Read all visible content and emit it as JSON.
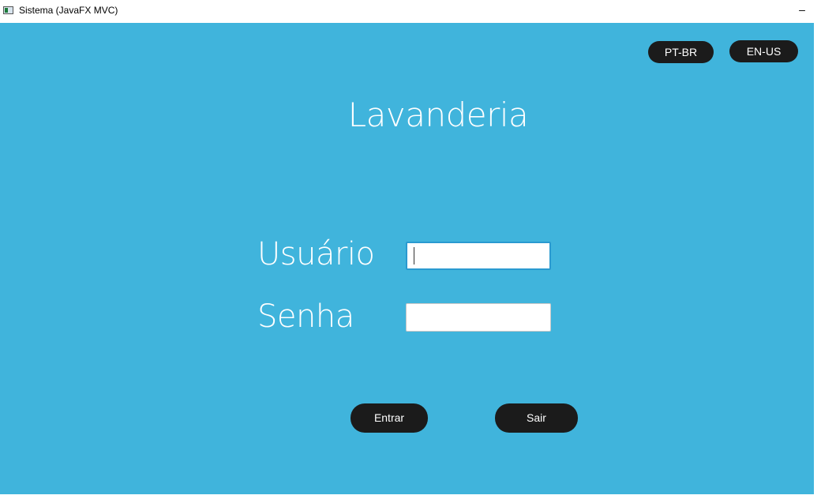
{
  "window": {
    "title": "Sistema (JavaFX MVC)",
    "minimize_glyph": "–"
  },
  "language": {
    "pt_label": "PT-BR",
    "en_label": "EN-US"
  },
  "heading": "Lavanderia",
  "form": {
    "user_label": "Usuário",
    "user_value": "",
    "password_label": "Senha",
    "password_value": ""
  },
  "actions": {
    "enter_label": "Entrar",
    "exit_label": "Sair"
  },
  "colors": {
    "background": "#40b4dc",
    "button": "#1b1b1b",
    "text": "#ffffff",
    "focus": "#2a9ad0"
  }
}
